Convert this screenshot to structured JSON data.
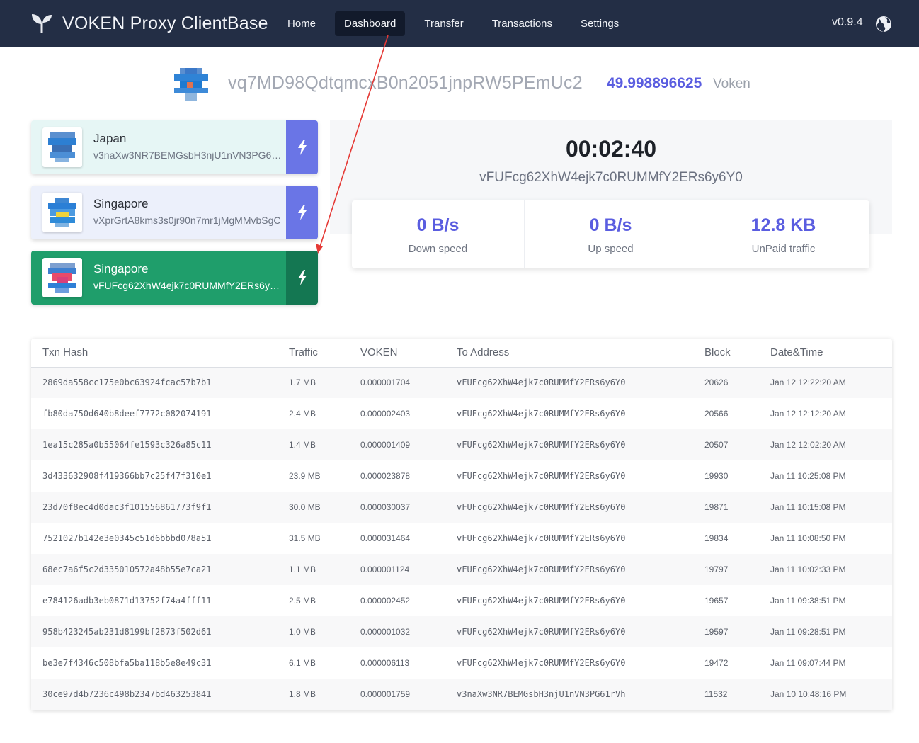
{
  "navbar": {
    "brand": "VOKEN Proxy ClientBase",
    "items": [
      {
        "label": "Home"
      },
      {
        "label": "Dashboard"
      },
      {
        "label": "Transfer"
      },
      {
        "label": "Transactions"
      },
      {
        "label": "Settings"
      }
    ],
    "active": "Dashboard",
    "version": "v0.9.4"
  },
  "account": {
    "address": "vq7MD98QdtqmcxB0n2051jnpRW5PEmUc2",
    "balance": "49.998896625",
    "unit": "Voken"
  },
  "nodes": [
    {
      "name": "Japan",
      "address": "v3naXw3NR7BEMGsbH3njU1nVN3PG61rVh",
      "state": "idle"
    },
    {
      "name": "Singapore",
      "address": "vXprGrtA8kms3s0jr90n7mr1jMgMMvbSgC",
      "state": "idle"
    },
    {
      "name": "Singapore",
      "address": "vFUFcg62XhW4ejk7c0RUMMfY2ERs6y6Y0",
      "state": "connected"
    }
  ],
  "status": {
    "timer": "00:02:40",
    "address": "vFUFcg62XhW4ejk7c0RUMMfY2ERs6y6Y0",
    "stats": [
      {
        "value": "0 B/s",
        "label": "Down speed"
      },
      {
        "value": "0 B/s",
        "label": "Up speed"
      },
      {
        "value": "12.8 KB",
        "label": "UnPaid traffic"
      }
    ]
  },
  "table": {
    "headers": [
      "Txn Hash",
      "Traffic",
      "VOKEN",
      "To Address",
      "Block",
      "Date&Time"
    ],
    "rows": [
      [
        "2869da558cc175e0bc63924fcac57b7b1",
        "1.7 MB",
        "0.000001704",
        "vFUFcg62XhW4ejk7c0RUMMfY2ERs6y6Y0",
        "20626",
        "Jan 12 12:22:20 AM"
      ],
      [
        "fb80da750d640b8deef7772c082074191",
        "2.4 MB",
        "0.000002403",
        "vFUFcg62XhW4ejk7c0RUMMfY2ERs6y6Y0",
        "20566",
        "Jan 12 12:12:20 AM"
      ],
      [
        "1ea15c285a0b55064fe1593c326a85c11",
        "1.4 MB",
        "0.000001409",
        "vFUFcg62XhW4ejk7c0RUMMfY2ERs6y6Y0",
        "20507",
        "Jan 12 12:02:20 AM"
      ],
      [
        "3d433632908f419366bb7c25f47f310e1",
        "23.9 MB",
        "0.000023878",
        "vFUFcg62XhW4ejk7c0RUMMfY2ERs6y6Y0",
        "19930",
        "Jan 11 10:25:08 PM"
      ],
      [
        "23d70f8ec4d0dac3f101556861773f9f1",
        "30.0 MB",
        "0.000030037",
        "vFUFcg62XhW4ejk7c0RUMMfY2ERs6y6Y0",
        "19871",
        "Jan 11 10:15:08 PM"
      ],
      [
        "7521027b142e3e0345c51d6bbbd078a51",
        "31.5 MB",
        "0.000031464",
        "vFUFcg62XhW4ejk7c0RUMMfY2ERs6y6Y0",
        "19834",
        "Jan 11 10:08:50 PM"
      ],
      [
        "68ec7a6f5c2d335010572a48b55e7ca21",
        "1.1 MB",
        "0.000001124",
        "vFUFcg62XhW4ejk7c0RUMMfY2ERs6y6Y0",
        "19797",
        "Jan 11 10:02:33 PM"
      ],
      [
        "e784126adb3eb0871d13752f74a4fff11",
        "2.5 MB",
        "0.000002452",
        "vFUFcg62XhW4ejk7c0RUMMfY2ERs6y6Y0",
        "19657",
        "Jan 11 09:38:51 PM"
      ],
      [
        "958b423245ab231d8199bf2873f502d61",
        "1.0 MB",
        "0.000001032",
        "vFUFcg62XhW4ejk7c0RUMMfY2ERs6y6Y0",
        "19597",
        "Jan 11 09:28:51 PM"
      ],
      [
        "be3e7f4346c508bfa5ba118b5e8e49c31",
        "6.1 MB",
        "0.000006113",
        "vFUFcg62XhW4ejk7c0RUMMfY2ERs6y6Y0",
        "19472",
        "Jan 11 09:07:44 PM"
      ],
      [
        "30ce97d4b7236c498b2347bd463253841",
        "1.8 MB",
        "0.000001759",
        "v3naXw3NR7BEMGsbH3njU1nVN3PG61rVh",
        "11532",
        "Jan 10 10:48:16 PM"
      ]
    ]
  },
  "colors": {
    "navbar": "#232e45",
    "accent": "#5a5de0",
    "connected": "#1f9e6b",
    "annotation": "#e53935"
  },
  "icons": [
    "leaf-logo-icon",
    "globe-icon",
    "bolt-icon",
    "identicon"
  ]
}
